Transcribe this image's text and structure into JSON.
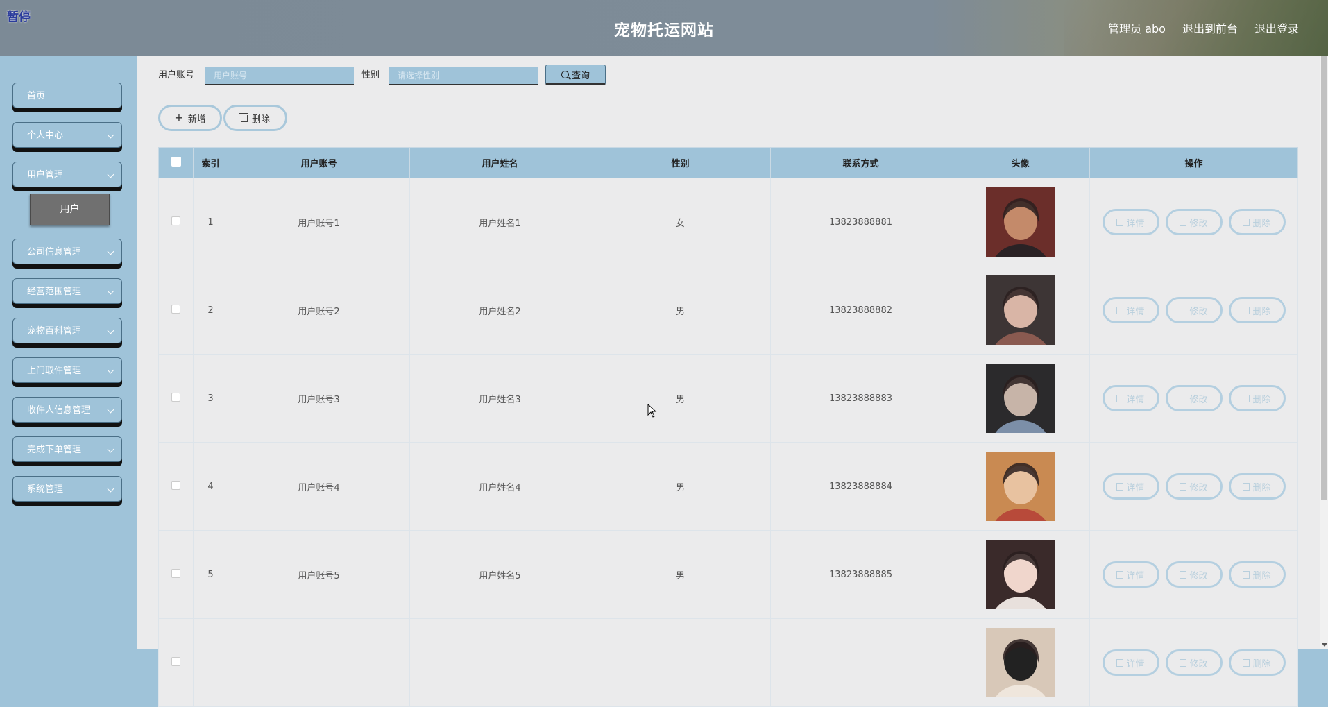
{
  "header": {
    "pause_label": "暂停",
    "title": "宠物托运网站",
    "admin_label": "管理员 abo",
    "front_link": "退出到前台",
    "logout_link": "退出登录"
  },
  "sidebar": {
    "items": [
      {
        "label": "首页",
        "expandable": false
      },
      {
        "label": "个人中心",
        "expandable": true
      },
      {
        "label": "用户管理",
        "expandable": true
      },
      {
        "label": "公司信息管理",
        "expandable": true
      },
      {
        "label": "经营范围管理",
        "expandable": true
      },
      {
        "label": "宠物百科管理",
        "expandable": true
      },
      {
        "label": "上门取件管理",
        "expandable": true
      },
      {
        "label": "收件人信息管理",
        "expandable": true
      },
      {
        "label": "完成下单管理",
        "expandable": true
      },
      {
        "label": "系统管理",
        "expandable": true
      }
    ],
    "active_sub": "用户"
  },
  "filters": {
    "account_label": "用户账号",
    "account_placeholder": "用户账号",
    "gender_label": "性别",
    "gender_placeholder": "请选择性别",
    "search_button": "查询"
  },
  "actions": {
    "add_button": "新增",
    "delete_button": "删除"
  },
  "table": {
    "columns": [
      "索引",
      "用户账号",
      "用户姓名",
      "性别",
      "联系方式",
      "头像",
      "操作"
    ],
    "row_actions": {
      "detail": "详情",
      "edit": "修改",
      "delete": "删除"
    },
    "rows": [
      {
        "index": "1",
        "account": "用户账号1",
        "name": "用户姓名1",
        "gender": "女",
        "phone": "13823888881",
        "avatar_colors": [
          "#6b2e2a",
          "#c48a6a",
          "#2a2225"
        ]
      },
      {
        "index": "2",
        "account": "用户账号2",
        "name": "用户姓名2",
        "gender": "男",
        "phone": "13823888882",
        "avatar_colors": [
          "#3d3535",
          "#d9b5a6",
          "#8a5a50"
        ]
      },
      {
        "index": "3",
        "account": "用户账号3",
        "name": "用户姓名3",
        "gender": "男",
        "phone": "13823888883",
        "avatar_colors": [
          "#2b2a2c",
          "#c7b4a8",
          "#7c8fa8"
        ]
      },
      {
        "index": "4",
        "account": "用户账号4",
        "name": "用户姓名4",
        "gender": "男",
        "phone": "13823888884",
        "avatar_colors": [
          "#c98a52",
          "#e8c2a0",
          "#b84a3a"
        ]
      },
      {
        "index": "5",
        "account": "用户账号5",
        "name": "用户姓名5",
        "gender": "男",
        "phone": "13823888885",
        "avatar_colors": [
          "#3a2a2a",
          "#f0d6cc",
          "#e8e0dc"
        ]
      },
      {
        "index": "",
        "account": "",
        "name": "",
        "gender": "",
        "phone": "",
        "avatar_colors": [
          "#d8c8b8",
          "#222222",
          "#efe6dc"
        ]
      }
    ]
  },
  "colors": {
    "accent": "#9fc3d9",
    "header_bg": "#7c8a96",
    "content_bg": "#ebebec"
  }
}
